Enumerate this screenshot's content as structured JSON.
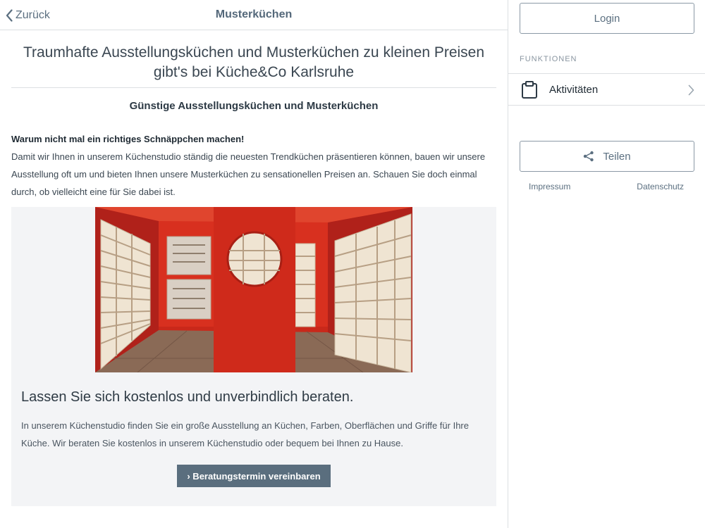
{
  "nav": {
    "back_label": "Zurück",
    "title": "Musterküchen"
  },
  "content": {
    "headline": "Traumhafte Ausstellungsküchen und Musterküchen zu kleinen Preisen gibt's bei Küche&Co Karlsruhe",
    "subheadline": "Günstige Ausstellungsküchen und Musterküchen",
    "intro_title": "Warum nicht mal ein richtiges Schnäppchen machen!",
    "intro_text": "Damit wir Ihnen in unserem Küchenstudio ständig die neuesten Trendküchen präsentieren können, bauen wir unsere Ausstellung oft um und bieten Ihnen unsere Musterküchen zu sensationellen Preisen an. Schauen Sie doch einmal durch, ob vielleicht eine für Sie dabei ist.",
    "panel_title": "Lassen Sie sich kostenlos und unverbindlich beraten.",
    "panel_text": "In unserem Küchenstudio finden Sie ein große Ausstellung an Küchen, Farben, Oberflächen und Griffe für Ihre Küche. Wir beraten Sie kostenlos in unserem Küchenstudio oder bequem bei Ihnen zu Hause.",
    "cta_label": "› Beratungstermin vereinbaren"
  },
  "sidebar": {
    "login_label": "Login",
    "section_label": "FUNKTIONEN",
    "activity_label": "Aktivitäten",
    "share_label": "Teilen",
    "impressum_label": "Impressum",
    "datenschutz_label": "Datenschutz"
  },
  "colors": {
    "accent": "#5a6e7e",
    "showroom_red": "#d8301f",
    "panel_bg": "#f3f4f6"
  },
  "icons": {
    "back": "chevron-left-icon",
    "activity": "clipboard-icon",
    "activity_arrow": "chevron-right-icon",
    "share": "share-icon"
  }
}
